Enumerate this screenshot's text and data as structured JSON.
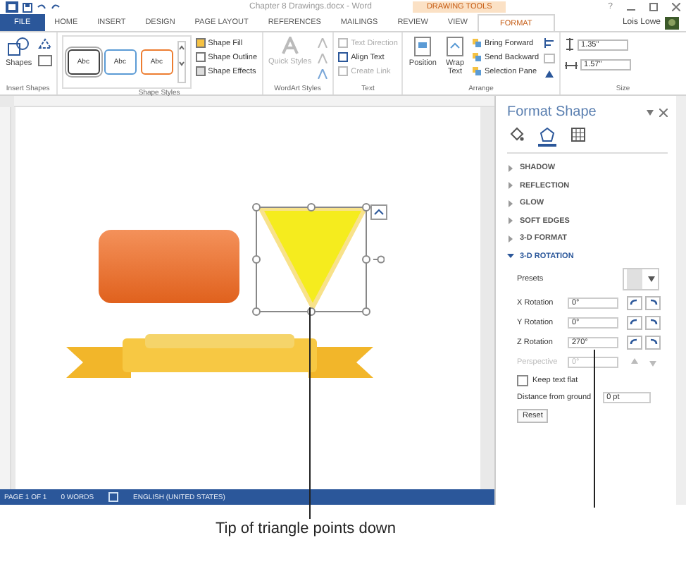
{
  "window": {
    "title": "Chapter 8 Drawings.docx - Word",
    "context_label": "DRAWING TOOLS",
    "help": "?"
  },
  "tabs": [
    {
      "label": "FILE",
      "kind": "file",
      "selected": false
    },
    {
      "label": "HOME",
      "kind": "tab",
      "selected": false
    },
    {
      "label": "INSERT",
      "kind": "tab",
      "selected": false
    },
    {
      "label": "DESIGN",
      "kind": "tab",
      "selected": false
    },
    {
      "label": "PAGE LAYOUT",
      "kind": "tab",
      "selected": false
    },
    {
      "label": "REFERENCES",
      "kind": "tab",
      "selected": false
    },
    {
      "label": "MAILINGS",
      "kind": "tab",
      "selected": false
    },
    {
      "label": "REVIEW",
      "kind": "tab",
      "selected": false
    },
    {
      "label": "VIEW",
      "kind": "tab",
      "selected": false
    },
    {
      "label": "FORMAT",
      "kind": "tab",
      "selected": true
    }
  ],
  "user": {
    "name": "Lois Lowe"
  },
  "ribbon": {
    "insert_shapes": {
      "label": "Insert Shapes",
      "shapes_button": "Shapes"
    },
    "shape_styles": {
      "label": "Shape Styles",
      "swatches": [
        {
          "text": "Abc",
          "color": "#404040",
          "selected": true
        },
        {
          "text": "Abc",
          "color": "#5b9bd5",
          "selected": false
        },
        {
          "text": "Abc",
          "color": "#ed7d31",
          "selected": false
        }
      ],
      "commands": [
        "Shape Fill",
        "Shape Outline",
        "Shape Effects"
      ]
    },
    "wordart": {
      "label": "WordArt Styles",
      "quick_styles": "Quick Styles"
    },
    "text": {
      "label": "Text",
      "commands": [
        {
          "label": "Text Direction",
          "disabled": true
        },
        {
          "label": "Align Text",
          "disabled": false
        },
        {
          "label": "Create Link",
          "disabled": true
        }
      ]
    },
    "arrange": {
      "label": "Arrange",
      "position": "Position",
      "wrap_text": "Wrap Text",
      "commands": [
        "Bring Forward",
        "Send Backward",
        "Selection Pane"
      ]
    },
    "size": {
      "label": "Size",
      "height": "1.35\"",
      "width": "1.57\""
    }
  },
  "canvas": {
    "shapes": [
      {
        "kind": "rounded_rect",
        "selected": false
      },
      {
        "kind": "triangle",
        "selected": true
      },
      {
        "kind": "banner",
        "selected": false
      }
    ]
  },
  "pane": {
    "title": "Format Shape",
    "tabs": [
      {
        "kind": "fill",
        "selected": false
      },
      {
        "kind": "effects",
        "selected": true
      },
      {
        "kind": "layout",
        "selected": false
      }
    ],
    "sections": [
      {
        "label": "SHADOW",
        "expanded": false
      },
      {
        "label": "REFLECTION",
        "expanded": false
      },
      {
        "label": "GLOW",
        "expanded": false
      },
      {
        "label": "SOFT EDGES",
        "expanded": false
      },
      {
        "label": "3-D FORMAT",
        "expanded": false
      },
      {
        "label": "3-D ROTATION",
        "expanded": true
      }
    ],
    "presets_label": "Presets",
    "rotations": [
      {
        "label": "X Rotation",
        "value": "0°",
        "disabled": false
      },
      {
        "label": "Y Rotation",
        "value": "0°",
        "disabled": false
      },
      {
        "label": "Z Rotation",
        "value": "270°",
        "disabled": false
      },
      {
        "label": "Perspective",
        "value": "0°",
        "disabled": true
      }
    ],
    "keep_text_flat": {
      "label": "Keep text flat",
      "checked": false
    },
    "distance": {
      "label": "Distance from ground",
      "value": "0 pt"
    },
    "reset": "Reset"
  },
  "status_bar": {
    "items": [
      "PAGE 1 OF 1",
      "0 WORDS",
      "ENGLISH (UNITED STATES)"
    ]
  },
  "caption": "Tip of triangle points down"
}
